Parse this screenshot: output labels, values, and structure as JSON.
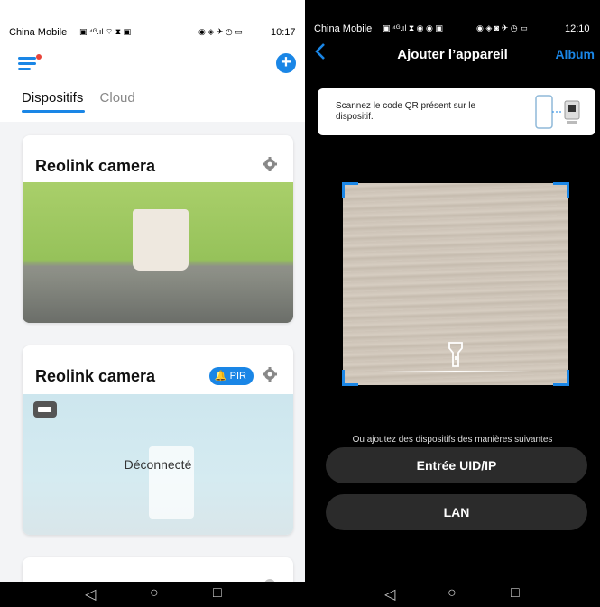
{
  "left": {
    "status": {
      "carrier": "China Mobile",
      "time": "10:17",
      "battery": "40"
    },
    "tabs": [
      {
        "label": "Dispositifs",
        "active": true
      },
      {
        "label": "Cloud",
        "active": false
      }
    ],
    "cards": [
      {
        "name": "Reolink camera",
        "overlay": "",
        "badge": ""
      },
      {
        "name": "Reolink camera",
        "overlay": "Déconnecté",
        "badge": "PIR"
      }
    ],
    "colors": {
      "accent": "#1a86e6",
      "notify": "#e8443a"
    },
    "nav": [
      "◁",
      "○",
      "□"
    ]
  },
  "right": {
    "status": {
      "carrier": "China Mobile",
      "time": "12:10",
      "battery": "99"
    },
    "title": "Ajouter l’appareil",
    "album": "Album",
    "hint": "Scannez le code QR présent sur le dispositif.",
    "other_ways": "Ou ajoutez des dispositifs des manières suivantes",
    "buttons": {
      "uid": "Entrée UID/IP",
      "lan": "LAN"
    },
    "nav": [
      "◁",
      "○",
      "□"
    ]
  }
}
